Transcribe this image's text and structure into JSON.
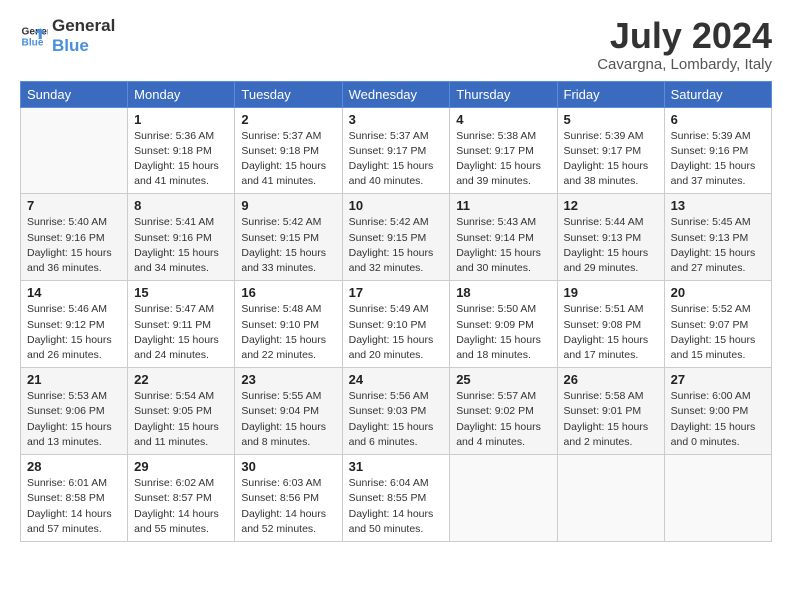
{
  "header": {
    "logo_line1": "General",
    "logo_line2": "Blue",
    "title": "July 2024",
    "location": "Cavargna, Lombardy, Italy"
  },
  "columns": [
    "Sunday",
    "Monday",
    "Tuesday",
    "Wednesday",
    "Thursday",
    "Friday",
    "Saturday"
  ],
  "weeks": [
    [
      {
        "day": "",
        "info": ""
      },
      {
        "day": "1",
        "info": "Sunrise: 5:36 AM\nSunset: 9:18 PM\nDaylight: 15 hours\nand 41 minutes."
      },
      {
        "day": "2",
        "info": "Sunrise: 5:37 AM\nSunset: 9:18 PM\nDaylight: 15 hours\nand 41 minutes."
      },
      {
        "day": "3",
        "info": "Sunrise: 5:37 AM\nSunset: 9:17 PM\nDaylight: 15 hours\nand 40 minutes."
      },
      {
        "day": "4",
        "info": "Sunrise: 5:38 AM\nSunset: 9:17 PM\nDaylight: 15 hours\nand 39 minutes."
      },
      {
        "day": "5",
        "info": "Sunrise: 5:39 AM\nSunset: 9:17 PM\nDaylight: 15 hours\nand 38 minutes."
      },
      {
        "day": "6",
        "info": "Sunrise: 5:39 AM\nSunset: 9:16 PM\nDaylight: 15 hours\nand 37 minutes."
      }
    ],
    [
      {
        "day": "7",
        "info": "Sunrise: 5:40 AM\nSunset: 9:16 PM\nDaylight: 15 hours\nand 36 minutes."
      },
      {
        "day": "8",
        "info": "Sunrise: 5:41 AM\nSunset: 9:16 PM\nDaylight: 15 hours\nand 34 minutes."
      },
      {
        "day": "9",
        "info": "Sunrise: 5:42 AM\nSunset: 9:15 PM\nDaylight: 15 hours\nand 33 minutes."
      },
      {
        "day": "10",
        "info": "Sunrise: 5:42 AM\nSunset: 9:15 PM\nDaylight: 15 hours\nand 32 minutes."
      },
      {
        "day": "11",
        "info": "Sunrise: 5:43 AM\nSunset: 9:14 PM\nDaylight: 15 hours\nand 30 minutes."
      },
      {
        "day": "12",
        "info": "Sunrise: 5:44 AM\nSunset: 9:13 PM\nDaylight: 15 hours\nand 29 minutes."
      },
      {
        "day": "13",
        "info": "Sunrise: 5:45 AM\nSunset: 9:13 PM\nDaylight: 15 hours\nand 27 minutes."
      }
    ],
    [
      {
        "day": "14",
        "info": "Sunrise: 5:46 AM\nSunset: 9:12 PM\nDaylight: 15 hours\nand 26 minutes."
      },
      {
        "day": "15",
        "info": "Sunrise: 5:47 AM\nSunset: 9:11 PM\nDaylight: 15 hours\nand 24 minutes."
      },
      {
        "day": "16",
        "info": "Sunrise: 5:48 AM\nSunset: 9:10 PM\nDaylight: 15 hours\nand 22 minutes."
      },
      {
        "day": "17",
        "info": "Sunrise: 5:49 AM\nSunset: 9:10 PM\nDaylight: 15 hours\nand 20 minutes."
      },
      {
        "day": "18",
        "info": "Sunrise: 5:50 AM\nSunset: 9:09 PM\nDaylight: 15 hours\nand 18 minutes."
      },
      {
        "day": "19",
        "info": "Sunrise: 5:51 AM\nSunset: 9:08 PM\nDaylight: 15 hours\nand 17 minutes."
      },
      {
        "day": "20",
        "info": "Sunrise: 5:52 AM\nSunset: 9:07 PM\nDaylight: 15 hours\nand 15 minutes."
      }
    ],
    [
      {
        "day": "21",
        "info": "Sunrise: 5:53 AM\nSunset: 9:06 PM\nDaylight: 15 hours\nand 13 minutes."
      },
      {
        "day": "22",
        "info": "Sunrise: 5:54 AM\nSunset: 9:05 PM\nDaylight: 15 hours\nand 11 minutes."
      },
      {
        "day": "23",
        "info": "Sunrise: 5:55 AM\nSunset: 9:04 PM\nDaylight: 15 hours\nand 8 minutes."
      },
      {
        "day": "24",
        "info": "Sunrise: 5:56 AM\nSunset: 9:03 PM\nDaylight: 15 hours\nand 6 minutes."
      },
      {
        "day": "25",
        "info": "Sunrise: 5:57 AM\nSunset: 9:02 PM\nDaylight: 15 hours\nand 4 minutes."
      },
      {
        "day": "26",
        "info": "Sunrise: 5:58 AM\nSunset: 9:01 PM\nDaylight: 15 hours\nand 2 minutes."
      },
      {
        "day": "27",
        "info": "Sunrise: 6:00 AM\nSunset: 9:00 PM\nDaylight: 15 hours\nand 0 minutes."
      }
    ],
    [
      {
        "day": "28",
        "info": "Sunrise: 6:01 AM\nSunset: 8:58 PM\nDaylight: 14 hours\nand 57 minutes."
      },
      {
        "day": "29",
        "info": "Sunrise: 6:02 AM\nSunset: 8:57 PM\nDaylight: 14 hours\nand 55 minutes."
      },
      {
        "day": "30",
        "info": "Sunrise: 6:03 AM\nSunset: 8:56 PM\nDaylight: 14 hours\nand 52 minutes."
      },
      {
        "day": "31",
        "info": "Sunrise: 6:04 AM\nSunset: 8:55 PM\nDaylight: 14 hours\nand 50 minutes."
      },
      {
        "day": "",
        "info": ""
      },
      {
        "day": "",
        "info": ""
      },
      {
        "day": "",
        "info": ""
      }
    ]
  ]
}
